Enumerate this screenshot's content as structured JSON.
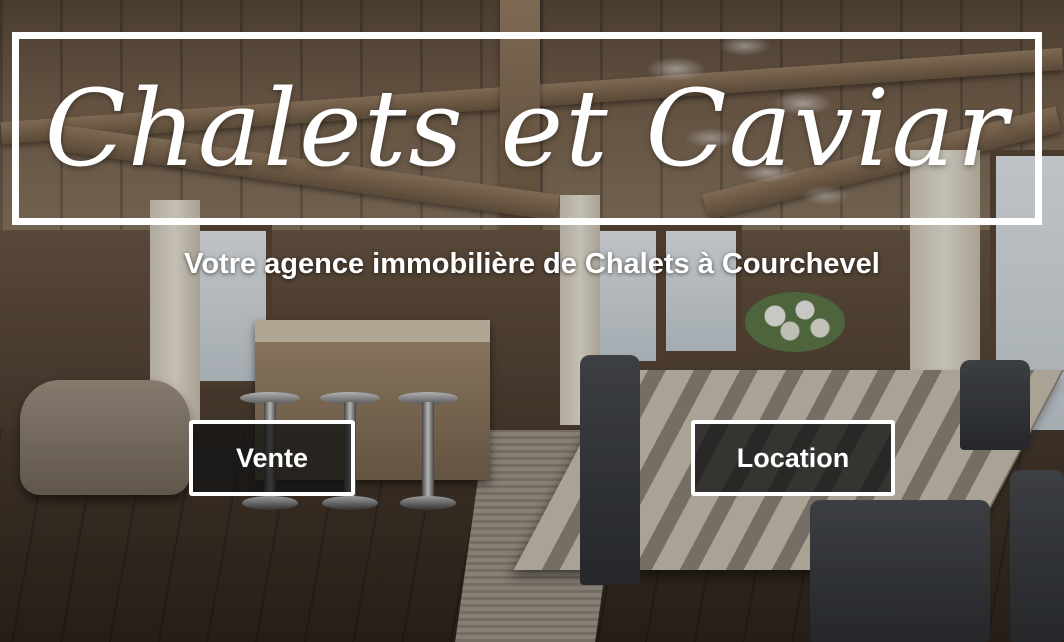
{
  "header": {
    "logo_text": "Chalets et Caviar",
    "tagline": "Votre agence immobilière de Chalets à Courchevel"
  },
  "actions": {
    "vente_label": "Vente",
    "location_label": "Location"
  },
  "colors": {
    "text": "#ffffff",
    "button_bg": "#141414",
    "frame": "#ffffff"
  }
}
